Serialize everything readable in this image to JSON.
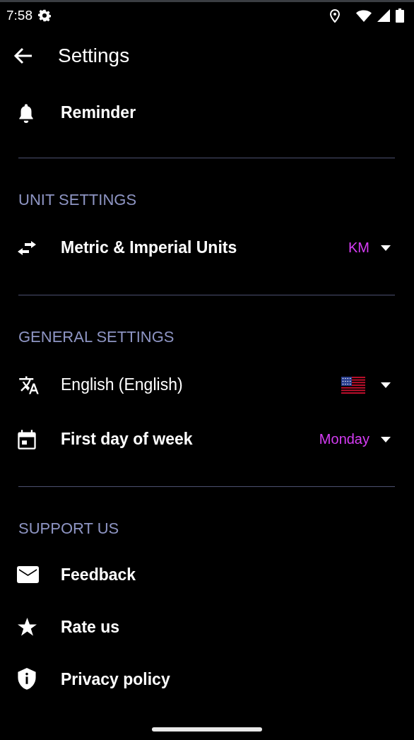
{
  "status_bar": {
    "time": "7:58"
  },
  "header": {
    "title": "Settings"
  },
  "sections": [
    {
      "items": [
        {
          "kind": "link",
          "label": "Reminder"
        }
      ]
    },
    {
      "title": "UNIT SETTINGS",
      "items": [
        {
          "kind": "select",
          "label": "Metric & Imperial Units",
          "value": "KM"
        }
      ]
    },
    {
      "title": "GENERAL SETTINGS",
      "items": [
        {
          "kind": "language",
          "label": "English (English)"
        },
        {
          "kind": "select",
          "label": "First day of week",
          "value": "Monday"
        }
      ]
    },
    {
      "title": "SUPPORT US",
      "items": [
        {
          "kind": "link",
          "label": "Feedback"
        },
        {
          "kind": "link",
          "label": "Rate us"
        },
        {
          "kind": "link",
          "label": "Privacy policy"
        }
      ]
    }
  ]
}
